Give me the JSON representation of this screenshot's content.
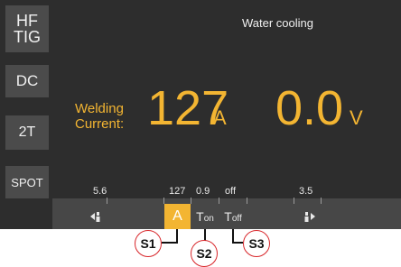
{
  "sidebar": {
    "mode": [
      "HF",
      "TIG"
    ],
    "polarity": "DC",
    "trigger": "2T",
    "spot": "SPOT"
  },
  "status": {
    "cooling": "Water cooling"
  },
  "main": {
    "label_line1": "Welding",
    "label_line2": "Current:",
    "current_value": "127",
    "current_unit": "A",
    "voltage_value": "0.0",
    "voltage_unit": "V"
  },
  "params": {
    "left_value": "5.6",
    "a_value": "127",
    "ton_value": "0.9",
    "toff_value": "off",
    "right_value": "3.5",
    "a_label": "A",
    "ton_main": "T",
    "ton_sub": "on",
    "toff_main": "T",
    "toff_sub": "off"
  },
  "callouts": {
    "s1": "S1",
    "s2": "S2",
    "s3": "S3"
  },
  "colors": {
    "accent": "#f3b532",
    "panel": "#2d2d2d",
    "button": "#4b4b4b",
    "callout": "#d8262a"
  }
}
